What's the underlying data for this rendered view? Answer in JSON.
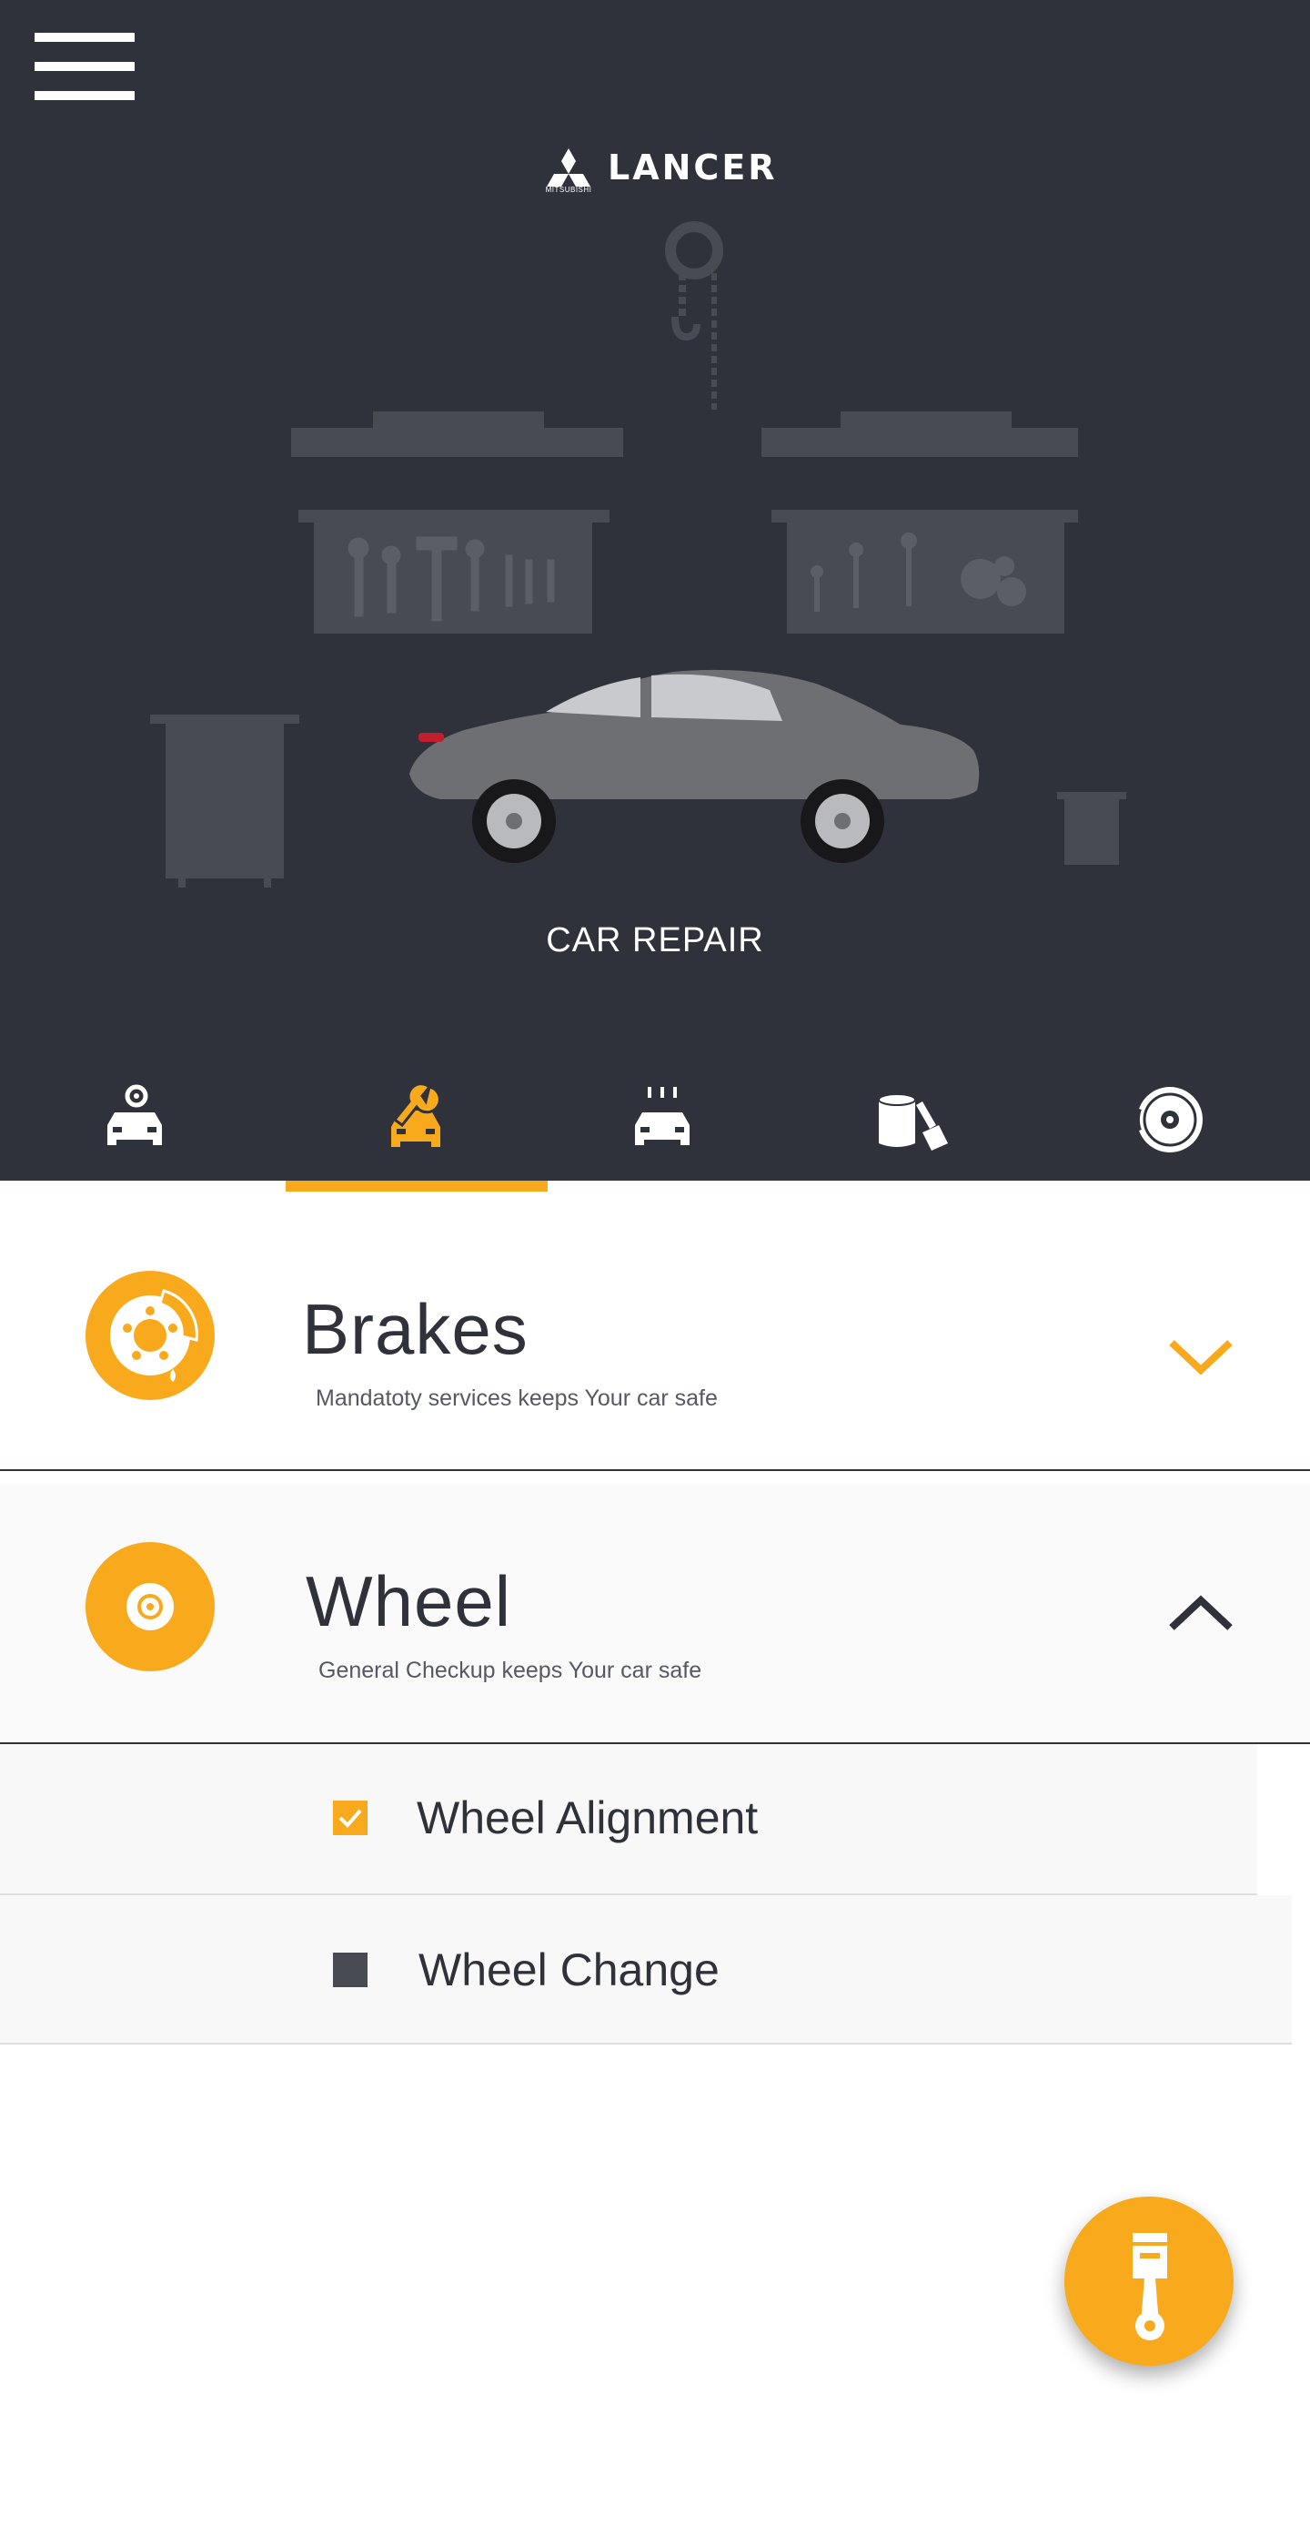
{
  "app": {
    "brand_name": "LANCER",
    "brand_sub": "MITSUBISHI"
  },
  "hero": {
    "title": "CAR REPAIR"
  },
  "tabs": [
    {
      "icon": "car-service-icon",
      "active": false
    },
    {
      "icon": "car-repair-wrench-icon",
      "active": true
    },
    {
      "icon": "car-wash-icon",
      "active": false
    },
    {
      "icon": "paint-bucket-brush-icon",
      "active": false
    },
    {
      "icon": "brake-disc-icon",
      "active": false
    }
  ],
  "sections": {
    "brakes": {
      "title": "Brakes",
      "subtitle": "Mandatoty services keeps Your car safe",
      "expanded": false
    },
    "wheel": {
      "title": "Wheel",
      "subtitle": "General Checkup keeps Your car safe",
      "expanded": true,
      "options": [
        {
          "label": "Wheel Alignment",
          "checked": true
        },
        {
          "label": "Wheel Change",
          "checked": false
        }
      ]
    }
  },
  "colors": {
    "accent": "#f9a91c",
    "dark": "#30323b",
    "garage": "#494b53"
  }
}
